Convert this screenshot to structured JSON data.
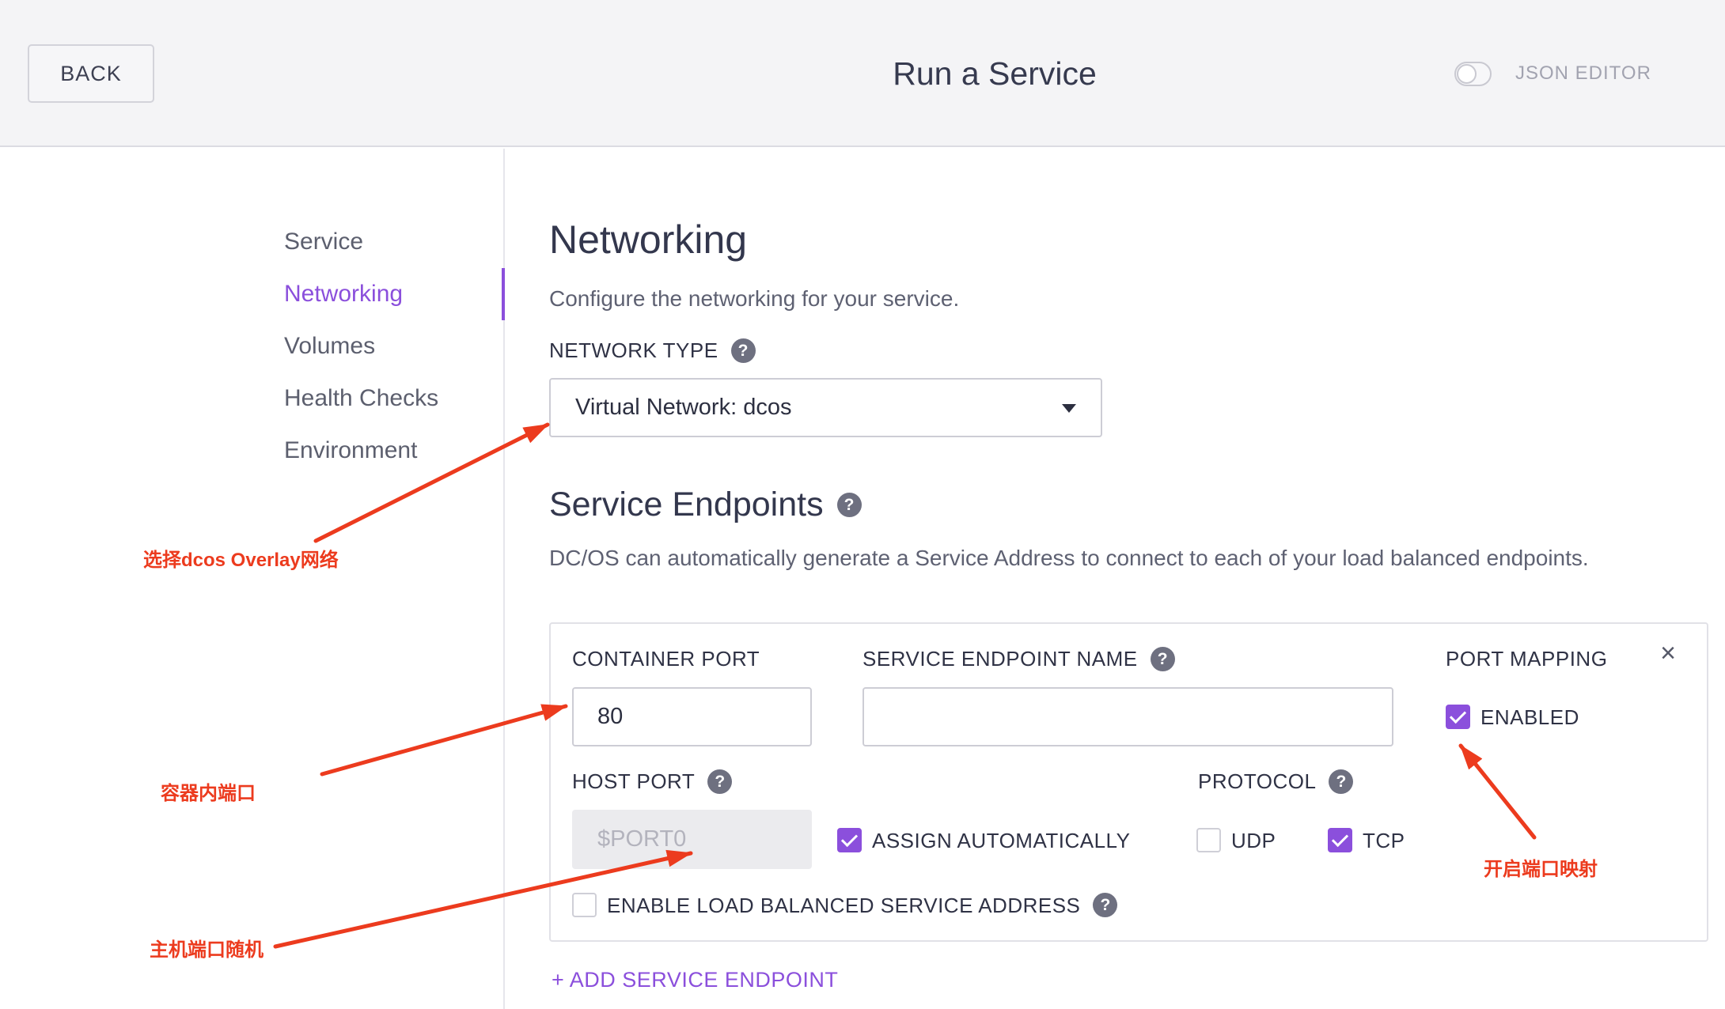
{
  "header": {
    "back_label": "BACK",
    "title": "Run a Service",
    "json_editor_label": "JSON EDITOR",
    "json_editor_enabled": false
  },
  "sidebar": {
    "items": [
      {
        "label": "Service",
        "active": false
      },
      {
        "label": "Networking",
        "active": true
      },
      {
        "label": "Volumes",
        "active": false
      },
      {
        "label": "Health Checks",
        "active": false
      },
      {
        "label": "Environment",
        "active": false
      }
    ]
  },
  "main": {
    "heading": "Networking",
    "description": "Configure the networking for your service.",
    "network_type": {
      "label": "NETWORK TYPE",
      "selected": "Virtual Network: dcos"
    },
    "service_endpoints": {
      "heading": "Service Endpoints",
      "description": "DC/OS can automatically generate a Service Address to connect to each of your load balanced endpoints.",
      "endpoints": [
        {
          "container_port": {
            "label": "CONTAINER PORT",
            "value": "80"
          },
          "endpoint_name": {
            "label": "SERVICE ENDPOINT NAME"
          },
          "port_mapping": {
            "label": "PORT MAPPING",
            "enabled_label": "ENABLED",
            "enabled": true
          },
          "host_port": {
            "label": "HOST PORT",
            "placeholder": "$PORT0",
            "assign_automatically_label": "ASSIGN AUTOMATICALLY",
            "assign_automatically": true
          },
          "protocol": {
            "label": "PROTOCOL",
            "options": [
              {
                "label": "UDP",
                "checked": false
              },
              {
                "label": "TCP",
                "checked": true
              }
            ]
          },
          "load_balanced": {
            "label": "ENABLE LOAD BALANCED SERVICE ADDRESS",
            "checked": false
          }
        }
      ],
      "add_label": "+ ADD SERVICE ENDPOINT"
    }
  },
  "annotations": [
    {
      "text": "选择dcos Overlay网络"
    },
    {
      "text": "容器内端口"
    },
    {
      "text": "主机端口随机"
    },
    {
      "text": "开启端口映射"
    }
  ],
  "glyphs": {
    "help": "?",
    "close": "×"
  },
  "icons": {
    "help": "help-icon",
    "close": "close-icon",
    "dropdown": "caret-down-icon",
    "checkbox": "check-icon",
    "toggle": "toggle-switch-icon",
    "annotation_arrow": "arrow-icon"
  },
  "colors": {
    "accent": "#8b4fdc",
    "annotation": "#ec3b1e",
    "text": "#343850",
    "muted": "#5e6172",
    "header_bg": "#f4f4f6",
    "border": "#cdcdd5",
    "help_icon": "#6e7080"
  }
}
